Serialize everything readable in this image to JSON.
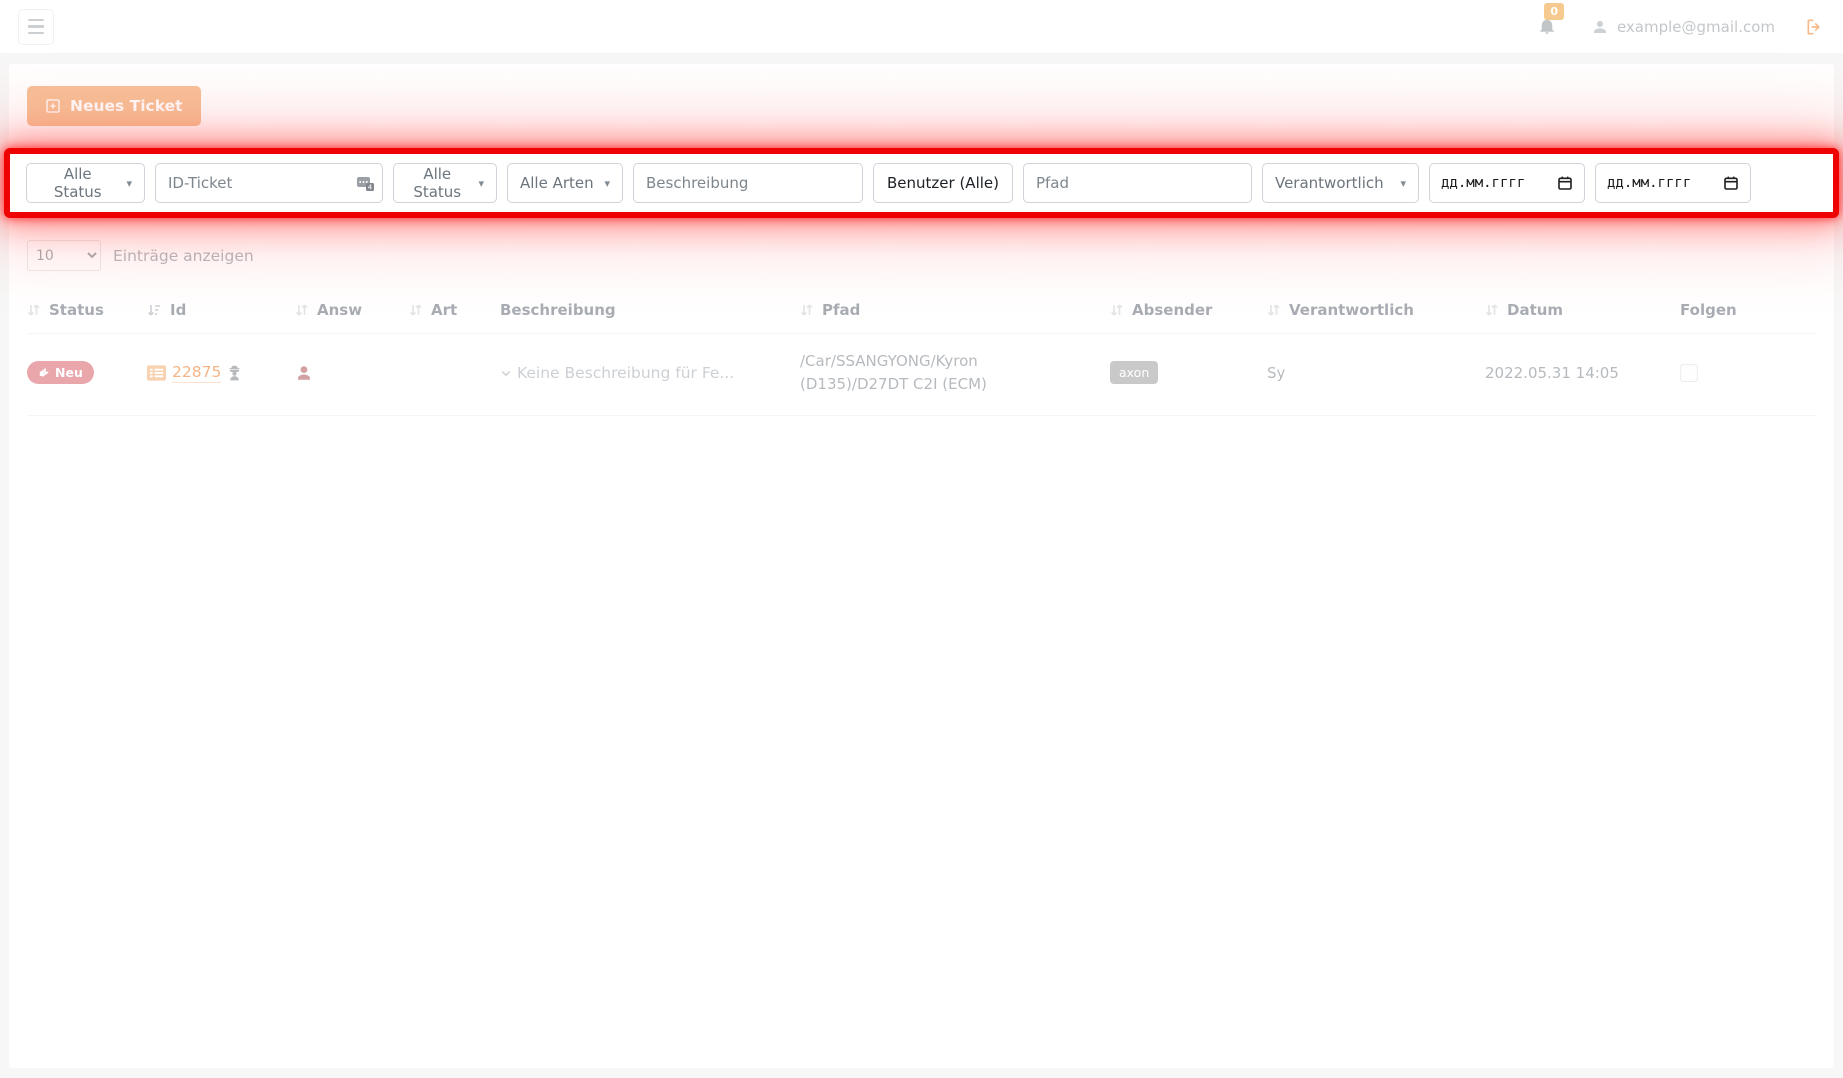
{
  "topbar": {
    "notification_count": "0",
    "email": "example@gmail.com"
  },
  "toolbar": {
    "new_ticket_label": "Neues Ticket"
  },
  "filter_bar": {
    "status_all_1": "Alle Status",
    "id_ticket_placeholder": "ID-Ticket",
    "status_all_2": "Alle Status",
    "art_all": "Alle Arten",
    "beschreibung_placeholder": "Beschreibung",
    "benutzer_label": "Benutzer (Alle)",
    "pfad_placeholder": "Pfad",
    "verantwortlich_label": "Verantwortlich",
    "date_from_placeholder": "дд.мм.гггг",
    "date_to_placeholder": "дд.мм.гггг"
  },
  "list_controls": {
    "page_size": "10",
    "entries_label": "Einträge anzeigen"
  },
  "table": {
    "headers": {
      "status": "Status",
      "id": "Id",
      "answ": "Answ",
      "art": "Art",
      "beschreibung": "Beschreibung",
      "pfad": "Pfad",
      "absender": "Absender",
      "verantwortlich": "Verantwortlich",
      "datum": "Datum",
      "folgen": "Folgen"
    },
    "row": {
      "status_badge": "Neu",
      "id": "22875",
      "beschreibung": "Keine Beschreibung für Fe...",
      "pfad": "/Car/SSANGYONG/Kyron (D135)/D27DT C2I (ECM)",
      "absender_badge": "axon",
      "verantwortlich": "Sy",
      "datum": "2022.05.31 14:05"
    }
  },
  "icons": {
    "caret_down": "▾",
    "names": [
      "menu-icon",
      "bell-icon",
      "notification-badge",
      "user-icon",
      "logout-icon",
      "plus-square-icon",
      "numpad-icon",
      "calendar-icon",
      "ticket-icon",
      "list-icon",
      "user-secret-icon",
      "person-icon",
      "chevron-down-icon",
      "sort-icon",
      "sort-active-icon"
    ]
  },
  "colors": {
    "accent_orange": "#ed8533",
    "id_link_orange": "#e96a0c",
    "danger_red": "#d34d57",
    "highlight_red": "#ee0202",
    "amber_badge": "#ed951d",
    "muted_gray": "#6c757d"
  }
}
